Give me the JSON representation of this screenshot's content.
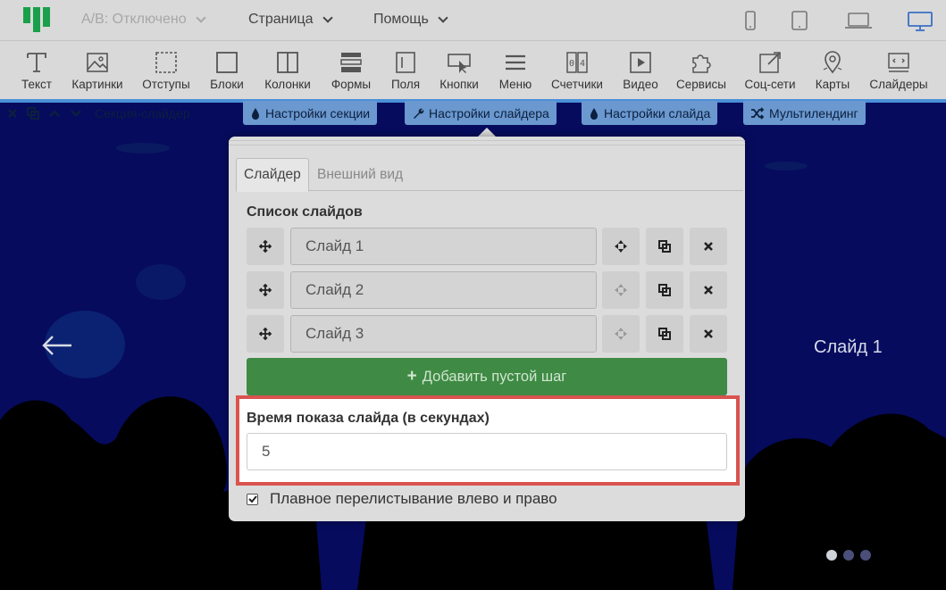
{
  "topbar": {
    "ab_label": "A/B: Отключено",
    "page_label": "Страница",
    "help_label": "Помощь"
  },
  "toolbar": {
    "items": [
      {
        "label": "Текст",
        "icon": "text-icon"
      },
      {
        "label": "Картинки",
        "icon": "image-icon"
      },
      {
        "label": "Отступы",
        "icon": "padding-icon"
      },
      {
        "label": "Блоки",
        "icon": "block-icon"
      },
      {
        "label": "Колонки",
        "icon": "columns-icon"
      },
      {
        "label": "Формы",
        "icon": "form-icon"
      },
      {
        "label": "Поля",
        "icon": "field-icon"
      },
      {
        "label": "Кнопки",
        "icon": "button-icon"
      },
      {
        "label": "Меню",
        "icon": "menu-icon"
      },
      {
        "label": "Счетчики",
        "icon": "counter-icon"
      },
      {
        "label": "Видео",
        "icon": "video-icon"
      },
      {
        "label": "Сервисы",
        "icon": "puzzle-icon"
      },
      {
        "label": "Соц-сети",
        "icon": "share-icon"
      },
      {
        "label": "Карты",
        "icon": "map-pin-icon"
      },
      {
        "label": "Слайдеры",
        "icon": "slider-icon"
      }
    ]
  },
  "section_bar": {
    "section_name": "Секция-слайдер",
    "section_settings": "Настройки секции",
    "slider_settings": "Настройки слайдера",
    "slide_settings": "Настройки слайда",
    "multilanding": "Мультилендинг"
  },
  "popup": {
    "tabs": [
      {
        "label": "Слайдер",
        "active": true
      },
      {
        "label": "Внешний вид",
        "active": false
      }
    ],
    "slides_title": "Список слайдов",
    "slides": [
      {
        "name": "Слайд 1"
      },
      {
        "name": "Слайд 2"
      },
      {
        "name": "Слайд 3"
      }
    ],
    "add_button": "Добавить пустой шаг",
    "duration_label": "Время показа слайда (в секундах)",
    "duration_value": "5",
    "smooth_label": "Плавное перелистывание влево и право",
    "smooth_checked": true
  },
  "slider": {
    "current_slide_label": "Слайд 1",
    "dots_count": 3,
    "active_dot": 0
  },
  "colors": {
    "accent_blue": "#6a98cf",
    "green": "#3f8a44",
    "highlight_red": "#d9534f",
    "logo_green": "#1aa04a"
  }
}
